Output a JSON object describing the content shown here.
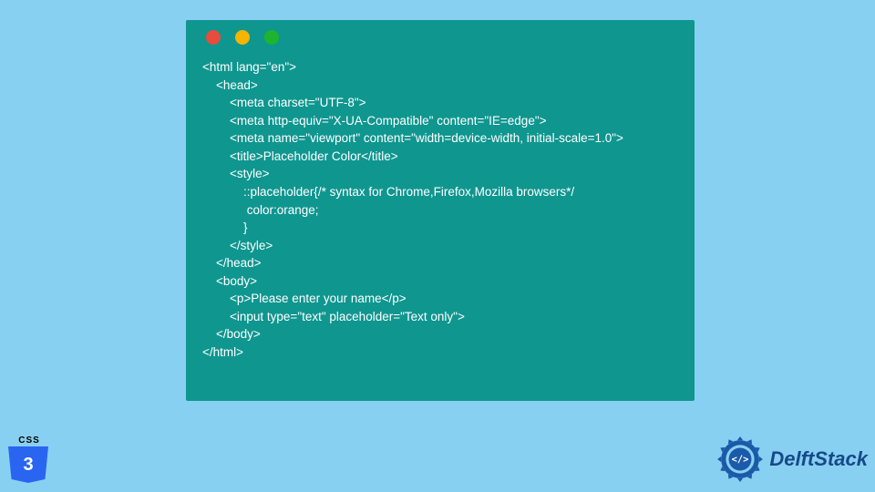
{
  "window": {
    "dots": {
      "red": "#e74c3c",
      "yellow": "#f5b400",
      "green": "#1fb42d"
    },
    "background": "#0f968f"
  },
  "code": {
    "lines": [
      "<html lang=\"en\">",
      "    <head>",
      "        <meta charset=\"UTF-8\">",
      "        <meta http-equiv=\"X-UA-Compatible\" content=\"IE=edge\">",
      "        <meta name=\"viewport\" content=\"width=device-width, initial-scale=1.0\">",
      "        <title>Placeholder Color</title>",
      "        <style>",
      "            ::placeholder{/* syntax for Chrome,Firefox,Mozilla browsers*/",
      "             color:orange;",
      "            }",
      "        </style>",
      "    </head>",
      "    <body>",
      "        <p>Please enter your name</p>",
      "        <input type=\"text\" placeholder=\"Text only\">",
      "    </body>",
      "</html>"
    ]
  },
  "logos": {
    "css": {
      "label": "CSS",
      "number": "3"
    },
    "brand": {
      "text": "DelftStack"
    }
  }
}
